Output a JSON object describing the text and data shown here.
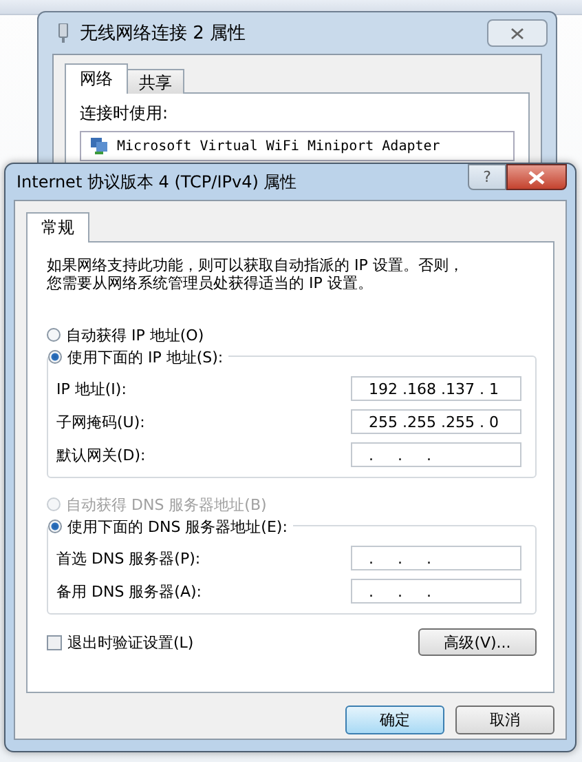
{
  "back_window": {
    "title": "无线网络连接 2 属性",
    "tabs": [
      {
        "label": "网络",
        "selected": true
      },
      {
        "label": "共享",
        "selected": false
      }
    ],
    "connect_using_label": "连接时使用:",
    "adapter": "Microsoft Virtual WiFi Miniport Adapter"
  },
  "dialog": {
    "title": "Internet 协议版本 4 (TCP/IPv4) 属性",
    "help_button": "?",
    "tabs": [
      {
        "label": "常规",
        "selected": true
      }
    ],
    "description": "如果网络支持此功能，则可以获取自动指派的 IP 设置。否则，您需要从网络系统管理员处获得适当的 IP 设置。",
    "sections": [
      {
        "auto_option": {
          "label": "自动获得 IP 地址(O)",
          "selected": false,
          "disabled": false
        },
        "manual_option": {
          "label": "使用下面的 IP 地址(S):",
          "selected": true
        },
        "fields": [
          {
            "label": "IP 地址(I):",
            "value": "192 .168 .137 . 1"
          },
          {
            "label": "子网掩码(U):",
            "value": "255 .255 .255 . 0"
          },
          {
            "label": "默认网关(D):",
            "value": ".     .     ."
          }
        ]
      },
      {
        "auto_option": {
          "label": "自动获得 DNS 服务器地址(B)",
          "selected": false,
          "disabled": true
        },
        "manual_option": {
          "label": "使用下面的 DNS 服务器地址(E):",
          "selected": true
        },
        "fields": [
          {
            "label": "首选 DNS 服务器(P):",
            "value": ".     .     ."
          },
          {
            "label": "备用 DNS 服务器(A):",
            "value": ".     .     ."
          }
        ]
      }
    ],
    "validate_checkbox": {
      "label": "退出时验证设置(L)",
      "checked": false
    },
    "advanced_button": "高级(V)...",
    "ok_button": "确定",
    "cancel_button": "取消"
  }
}
